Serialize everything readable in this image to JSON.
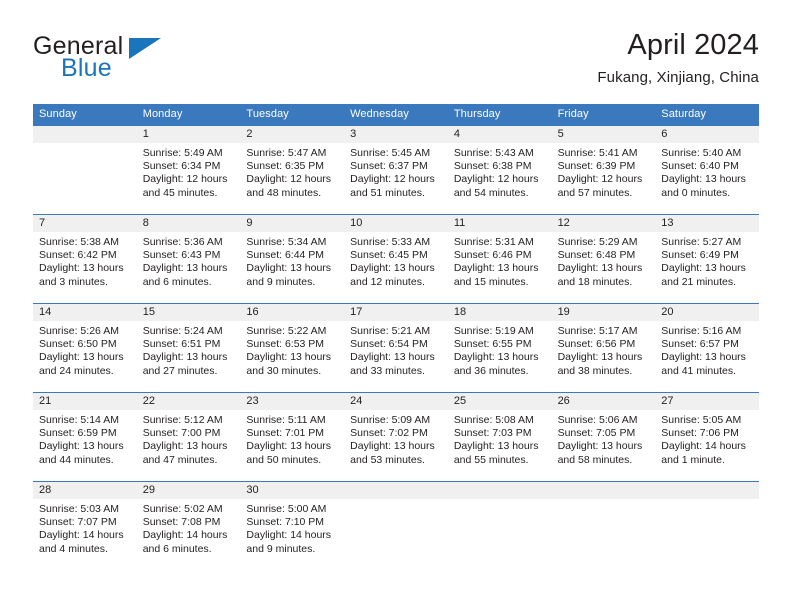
{
  "brand": {
    "name_part1": "General",
    "name_part2": "Blue",
    "accent_color": "#1b75bb",
    "triangle_icon": "brand-triangle-icon"
  },
  "header": {
    "title": "April 2024",
    "subtitle": "Fukang, Xinjiang, China"
  },
  "calendar": {
    "header_bg": "#3a79bd",
    "daynumber_bg": "#f0f0f0",
    "weekdays": [
      "Sunday",
      "Monday",
      "Tuesday",
      "Wednesday",
      "Thursday",
      "Friday",
      "Saturday"
    ],
    "weeks": [
      {
        "days": [
          {
            "number": "",
            "sunrise": "",
            "sunset": "",
            "daylight1": "",
            "daylight2": ""
          },
          {
            "number": "1",
            "sunrise": "Sunrise: 5:49 AM",
            "sunset": "Sunset: 6:34 PM",
            "daylight1": "Daylight: 12 hours",
            "daylight2": "and 45 minutes."
          },
          {
            "number": "2",
            "sunrise": "Sunrise: 5:47 AM",
            "sunset": "Sunset: 6:35 PM",
            "daylight1": "Daylight: 12 hours",
            "daylight2": "and 48 minutes."
          },
          {
            "number": "3",
            "sunrise": "Sunrise: 5:45 AM",
            "sunset": "Sunset: 6:37 PM",
            "daylight1": "Daylight: 12 hours",
            "daylight2": "and 51 minutes."
          },
          {
            "number": "4",
            "sunrise": "Sunrise: 5:43 AM",
            "sunset": "Sunset: 6:38 PM",
            "daylight1": "Daylight: 12 hours",
            "daylight2": "and 54 minutes."
          },
          {
            "number": "5",
            "sunrise": "Sunrise: 5:41 AM",
            "sunset": "Sunset: 6:39 PM",
            "daylight1": "Daylight: 12 hours",
            "daylight2": "and 57 minutes."
          },
          {
            "number": "6",
            "sunrise": "Sunrise: 5:40 AM",
            "sunset": "Sunset: 6:40 PM",
            "daylight1": "Daylight: 13 hours",
            "daylight2": "and 0 minutes."
          }
        ]
      },
      {
        "days": [
          {
            "number": "7",
            "sunrise": "Sunrise: 5:38 AM",
            "sunset": "Sunset: 6:42 PM",
            "daylight1": "Daylight: 13 hours",
            "daylight2": "and 3 minutes."
          },
          {
            "number": "8",
            "sunrise": "Sunrise: 5:36 AM",
            "sunset": "Sunset: 6:43 PM",
            "daylight1": "Daylight: 13 hours",
            "daylight2": "and 6 minutes."
          },
          {
            "number": "9",
            "sunrise": "Sunrise: 5:34 AM",
            "sunset": "Sunset: 6:44 PM",
            "daylight1": "Daylight: 13 hours",
            "daylight2": "and 9 minutes."
          },
          {
            "number": "10",
            "sunrise": "Sunrise: 5:33 AM",
            "sunset": "Sunset: 6:45 PM",
            "daylight1": "Daylight: 13 hours",
            "daylight2": "and 12 minutes."
          },
          {
            "number": "11",
            "sunrise": "Sunrise: 5:31 AM",
            "sunset": "Sunset: 6:46 PM",
            "daylight1": "Daylight: 13 hours",
            "daylight2": "and 15 minutes."
          },
          {
            "number": "12",
            "sunrise": "Sunrise: 5:29 AM",
            "sunset": "Sunset: 6:48 PM",
            "daylight1": "Daylight: 13 hours",
            "daylight2": "and 18 minutes."
          },
          {
            "number": "13",
            "sunrise": "Sunrise: 5:27 AM",
            "sunset": "Sunset: 6:49 PM",
            "daylight1": "Daylight: 13 hours",
            "daylight2": "and 21 minutes."
          }
        ]
      },
      {
        "days": [
          {
            "number": "14",
            "sunrise": "Sunrise: 5:26 AM",
            "sunset": "Sunset: 6:50 PM",
            "daylight1": "Daylight: 13 hours",
            "daylight2": "and 24 minutes."
          },
          {
            "number": "15",
            "sunrise": "Sunrise: 5:24 AM",
            "sunset": "Sunset: 6:51 PM",
            "daylight1": "Daylight: 13 hours",
            "daylight2": "and 27 minutes."
          },
          {
            "number": "16",
            "sunrise": "Sunrise: 5:22 AM",
            "sunset": "Sunset: 6:53 PM",
            "daylight1": "Daylight: 13 hours",
            "daylight2": "and 30 minutes."
          },
          {
            "number": "17",
            "sunrise": "Sunrise: 5:21 AM",
            "sunset": "Sunset: 6:54 PM",
            "daylight1": "Daylight: 13 hours",
            "daylight2": "and 33 minutes."
          },
          {
            "number": "18",
            "sunrise": "Sunrise: 5:19 AM",
            "sunset": "Sunset: 6:55 PM",
            "daylight1": "Daylight: 13 hours",
            "daylight2": "and 36 minutes."
          },
          {
            "number": "19",
            "sunrise": "Sunrise: 5:17 AM",
            "sunset": "Sunset: 6:56 PM",
            "daylight1": "Daylight: 13 hours",
            "daylight2": "and 38 minutes."
          },
          {
            "number": "20",
            "sunrise": "Sunrise: 5:16 AM",
            "sunset": "Sunset: 6:57 PM",
            "daylight1": "Daylight: 13 hours",
            "daylight2": "and 41 minutes."
          }
        ]
      },
      {
        "days": [
          {
            "number": "21",
            "sunrise": "Sunrise: 5:14 AM",
            "sunset": "Sunset: 6:59 PM",
            "daylight1": "Daylight: 13 hours",
            "daylight2": "and 44 minutes."
          },
          {
            "number": "22",
            "sunrise": "Sunrise: 5:12 AM",
            "sunset": "Sunset: 7:00 PM",
            "daylight1": "Daylight: 13 hours",
            "daylight2": "and 47 minutes."
          },
          {
            "number": "23",
            "sunrise": "Sunrise: 5:11 AM",
            "sunset": "Sunset: 7:01 PM",
            "daylight1": "Daylight: 13 hours",
            "daylight2": "and 50 minutes."
          },
          {
            "number": "24",
            "sunrise": "Sunrise: 5:09 AM",
            "sunset": "Sunset: 7:02 PM",
            "daylight1": "Daylight: 13 hours",
            "daylight2": "and 53 minutes."
          },
          {
            "number": "25",
            "sunrise": "Sunrise: 5:08 AM",
            "sunset": "Sunset: 7:03 PM",
            "daylight1": "Daylight: 13 hours",
            "daylight2": "and 55 minutes."
          },
          {
            "number": "26",
            "sunrise": "Sunrise: 5:06 AM",
            "sunset": "Sunset: 7:05 PM",
            "daylight1": "Daylight: 13 hours",
            "daylight2": "and 58 minutes."
          },
          {
            "number": "27",
            "sunrise": "Sunrise: 5:05 AM",
            "sunset": "Sunset: 7:06 PM",
            "daylight1": "Daylight: 14 hours",
            "daylight2": "and 1 minute."
          }
        ]
      },
      {
        "days": [
          {
            "number": "28",
            "sunrise": "Sunrise: 5:03 AM",
            "sunset": "Sunset: 7:07 PM",
            "daylight1": "Daylight: 14 hours",
            "daylight2": "and 4 minutes."
          },
          {
            "number": "29",
            "sunrise": "Sunrise: 5:02 AM",
            "sunset": "Sunset: 7:08 PM",
            "daylight1": "Daylight: 14 hours",
            "daylight2": "and 6 minutes."
          },
          {
            "number": "30",
            "sunrise": "Sunrise: 5:00 AM",
            "sunset": "Sunset: 7:10 PM",
            "daylight1": "Daylight: 14 hours",
            "daylight2": "and 9 minutes."
          },
          {
            "number": "",
            "sunrise": "",
            "sunset": "",
            "daylight1": "",
            "daylight2": ""
          },
          {
            "number": "",
            "sunrise": "",
            "sunset": "",
            "daylight1": "",
            "daylight2": ""
          },
          {
            "number": "",
            "sunrise": "",
            "sunset": "",
            "daylight1": "",
            "daylight2": ""
          },
          {
            "number": "",
            "sunrise": "",
            "sunset": "",
            "daylight1": "",
            "daylight2": ""
          }
        ]
      }
    ]
  }
}
